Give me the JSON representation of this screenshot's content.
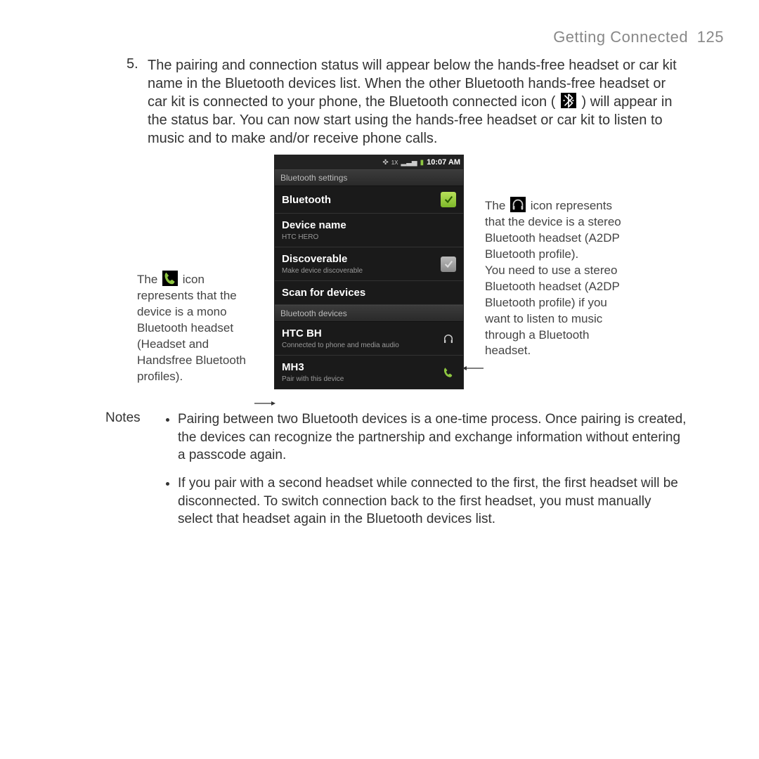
{
  "header": {
    "title": "Getting Connected",
    "page": "125"
  },
  "step": {
    "num": "5.",
    "text_a": "The pairing and connection status will appear below the hands-free headset or car kit name in the Bluetooth devices list. When the other Bluetooth hands-free headset or car kit is connected to your phone, the Bluetooth connected icon (",
    "text_b": ") will appear in the status bar. You can now start using the hands-free headset or car kit to listen to music and to make and/or receive phone calls."
  },
  "callout_left": {
    "pre": "The ",
    "post": " icon represents that the device is a mono Bluetooth headset (Headset and Handsfree Bluetooth profiles)."
  },
  "callout_right": {
    "pre": "The ",
    "post": " icon represents that the device is a stereo Bluetooth headset (A2DP Bluetooth profile).",
    "extra": "You need to use a stereo Bluetooth headset (A2DP Bluetooth profile) if you want to listen to music through a Bluetooth headset."
  },
  "phone": {
    "time": "10:07 AM",
    "hdr_settings": "Bluetooth settings",
    "bluetooth": "Bluetooth",
    "device_name": "Device name",
    "device_name_sub": "HTC HERO",
    "discoverable": "Discoverable",
    "discoverable_sub": "Make device discoverable",
    "scan": "Scan for devices",
    "hdr_devices": "Bluetooth devices",
    "dev1": "HTC BH",
    "dev1_sub": "Connected to phone and media audio",
    "dev2": "MH3",
    "dev2_sub": "Pair with this device"
  },
  "notes": {
    "label": "Notes",
    "items": [
      "Pairing between two Bluetooth devices is a one-time process. Once pairing is created, the devices can recognize the partnership and exchange information without entering a passcode again.",
      "If you pair with a second headset while connected to the first, the first headset will be disconnected. To switch connection back to the first headset, you must manually select that headset again in the Bluetooth devices list."
    ]
  }
}
